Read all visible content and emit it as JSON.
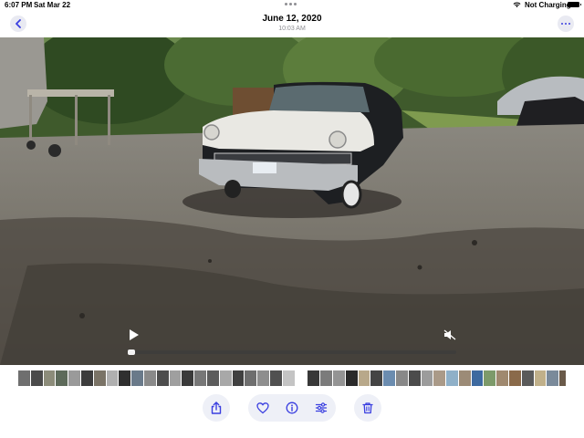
{
  "status_bar": {
    "time": "6:07 PM",
    "date": "Sat Mar 22",
    "charging_text": "Not Charging"
  },
  "header": {
    "title": "June 12, 2020",
    "subtitle": "10:03 AM",
    "back_icon": "chevron-left-icon",
    "more_icon": "ellipsis-icon"
  },
  "video": {
    "play_icon": "play-icon",
    "mute_icon": "speaker-muted-icon",
    "progress": 0.0
  },
  "thumbnail_strip": {
    "colors": [
      "#6f6f6f",
      "#4a4a4a",
      "#8c8c7a",
      "#5d6a5a",
      "#9a9a9a",
      "#3c3c3c",
      "#7a7366",
      "#b0b0b0",
      "#2f2f2f",
      "#6a7a8a",
      "#8a8a8a",
      "#4d4d4d",
      "#9f9f9f",
      "#3a3a3a",
      "#777777",
      "#5c5c5c",
      "#a8a8a8",
      "#404040",
      "#6e6e6e",
      "#8e8e8e",
      "#505050",
      "#c4c4c4",
      "#ffffff",
      "#383838",
      "#7b7b7b",
      "#949494",
      "#2a2a2a",
      "#b8a88a",
      "#444444",
      "#6b8caf",
      "#888888",
      "#4b4b4b",
      "#9c9c9c",
      "#aa9a88",
      "#8fb0c8",
      "#9c8b77",
      "#3e6aa0",
      "#7d9a6a",
      "#a0896f",
      "#8a6a4a",
      "#5a5a5a",
      "#c0b08a",
      "#7a8a9a",
      "#6a5a4a",
      "#a6a6a6",
      "#3f6f3f",
      "#9c7a5a",
      "#4a6a9a",
      "#b5b5b5",
      "#6a6a6a"
    ]
  },
  "toolbar": {
    "share_icon": "share-icon",
    "favorite_icon": "heart-icon",
    "info_icon": "info-icon",
    "adjust_icon": "sliders-icon",
    "delete_icon": "trash-icon",
    "accent_color": "#3a3fe0"
  }
}
